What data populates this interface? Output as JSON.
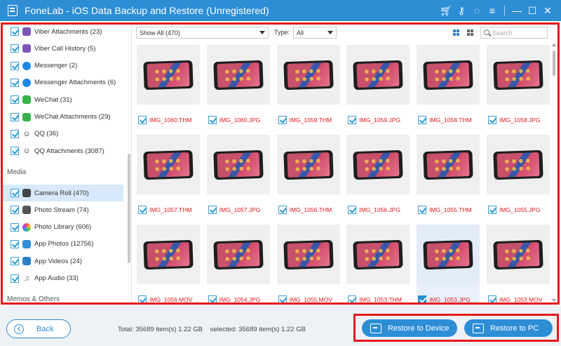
{
  "window": {
    "title": "FoneLab - iOS Data Backup and Restore (Unregistered)",
    "icons": [
      "cart-icon",
      "key-icon",
      "chat-icon",
      "menu-icon",
      "minimize-icon",
      "maximize-icon",
      "close-icon"
    ]
  },
  "sidebar": {
    "items_top": [
      {
        "label": "Viber Attachments (23)",
        "icon": "viber-icon"
      },
      {
        "label": "Viber Call History (5)",
        "icon": "viber-icon"
      },
      {
        "label": "Messenger (2)",
        "icon": "messenger-icon"
      },
      {
        "label": "Messenger Attachments (6)",
        "icon": "messenger-icon"
      },
      {
        "label": "WeChat (31)",
        "icon": "wechat-icon"
      },
      {
        "label": "WeChat Attachments (29)",
        "icon": "wechat-icon"
      },
      {
        "label": "QQ (36)",
        "icon": "qq-icon"
      },
      {
        "label": "QQ Attachments (3087)",
        "icon": "qq-icon"
      }
    ],
    "media_heading": "Media",
    "items_media": [
      {
        "label": "Camera Roll (470)",
        "icon": "camera-icon",
        "active": true
      },
      {
        "label": "Photo Stream (74)",
        "icon": "photo-stream-icon"
      },
      {
        "label": "Photo Library (606)",
        "icon": "photo-library-icon"
      },
      {
        "label": "App Photos (12756)",
        "icon": "app-photos-icon"
      },
      {
        "label": "App Videos (24)",
        "icon": "app-videos-icon"
      },
      {
        "label": "App Audio (33)",
        "icon": "music-icon"
      }
    ],
    "memos_heading": "Memos & Others"
  },
  "toolbar": {
    "filter_value": "Show All (470)",
    "type_label": "Type:",
    "type_value": "All",
    "search_placeholder": "Search"
  },
  "files": [
    "IMG_1060.THM",
    "IMG_1060.JPG",
    "IMG_1059.THM",
    "IMG_1059.JPG",
    "IMG_1058.THM",
    "IMG_1058.JPG",
    "IMG_1057.THM",
    "IMG_1057.JPG",
    "IMG_1056.THM",
    "IMG_1056.JPG",
    "IMG_1055.THM",
    "IMG_1055.JPG",
    "IMG_1056.MOV",
    "IMG_1054.JPG",
    "IMG_1055.MOV",
    "IMG_1053.THM",
    "IMG_1053.JPG",
    "IMG_1053.MOV"
  ],
  "selected_tile_index": 16,
  "footer": {
    "back_label": "Back",
    "total_text": "Total: 35689 item(s) 1.22 GB",
    "selected_text": "selected: 35689 item(s) 1.22 GB",
    "restore_device_label": "Restore to Device",
    "restore_pc_label": "Restore to PC"
  },
  "colors": {
    "titlebar": "#2d8ed6",
    "highlight_frame": "#e3191c",
    "filename": "#e3191c",
    "active_row": "#d7e9fa"
  }
}
